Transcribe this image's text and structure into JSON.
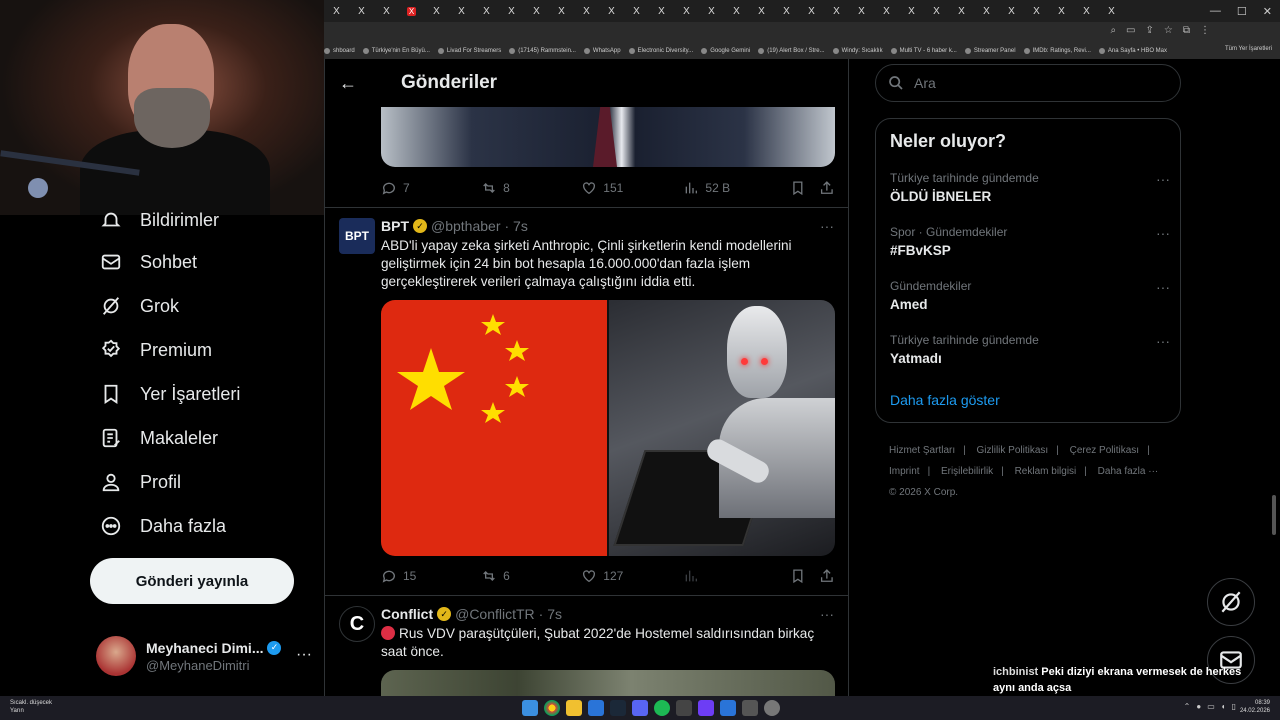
{
  "browser": {
    "tab_count": 32,
    "tab_glyph": "X",
    "bookmarks": [
      "shboard",
      "Türkiye'nin En Büyü...",
      "Livad For Streamers",
      "(17145) Rammstein...",
      "WhatsApp",
      "Electronic Diversity...",
      "Google Gemini",
      "(19) Alert Box / Stre...",
      "Windy: Sıcaklık",
      "Multi TV - 6 haber k...",
      "Streamer Panel",
      "IMDb: Ratings, Revi...",
      "Ana Sayfa • HBO Max"
    ],
    "bookmarks_folder": "Tüm Yer İşaretleri"
  },
  "nav": {
    "items": [
      {
        "label": "Bildirimler",
        "icon": "bell-icon"
      },
      {
        "label": "Sohbet",
        "icon": "mail-icon"
      },
      {
        "label": "Grok",
        "icon": "grok-icon"
      },
      {
        "label": "Premium",
        "icon": "premium-icon"
      },
      {
        "label": "Yer İşaretleri",
        "icon": "bookmark-icon"
      },
      {
        "label": "Makaleler",
        "icon": "article-icon"
      },
      {
        "label": "Profil",
        "icon": "profile-icon"
      },
      {
        "label": "Daha fazla",
        "icon": "more-icon"
      }
    ],
    "post_button": "Gönderi yayınla"
  },
  "account": {
    "name": "Meyhaneci Dimi...",
    "handle": "@MeyhaneDimitri"
  },
  "main": {
    "title": "Gönderiler",
    "prev_tweet_stats": {
      "replies": "7",
      "reposts": "8",
      "likes": "151",
      "views": "52 B"
    },
    "tweets": [
      {
        "name": "BPT",
        "handle": "@bpthaber",
        "time": "· 7s",
        "avatar_text": "BPT",
        "text": "ABD'li yapay zeka şirketi Anthropic, Çinli şirketlerin kendi modellerini geliştirmek için 24 bin bot hesapla 16.000.000'dan fazla işlem gerçekleştirerek verileri çalmaya çalıştığını iddia etti.",
        "stats": {
          "replies": "15",
          "reposts": "6",
          "likes": "127"
        }
      },
      {
        "name": "Conflict",
        "handle": "@ConflictTR",
        "time": "· 7s",
        "avatar_text": "C",
        "text": "Rus VDV paraşütçüleri, Şubat 2022'de Hostemel saldırısından birkaç saat önce."
      }
    ]
  },
  "search": {
    "placeholder": "Ara"
  },
  "trends": {
    "title": "Neler oluyor?",
    "items": [
      {
        "meta": "Türkiye tarihinde gündemde",
        "name": "ÖLDÜ İBNELER"
      },
      {
        "meta": "Spor · Gündemdekiler",
        "name": "#FBvKSP"
      },
      {
        "meta": "Gündemdekiler",
        "name": "Amed"
      },
      {
        "meta": "Türkiye tarihinde gündemde",
        "name": "Yatmadı"
      }
    ],
    "show_more": "Daha fazla göster"
  },
  "footer": {
    "links": [
      "Hizmet Şartları",
      "|",
      "Gizlilik Politikası",
      "|",
      "Çerez Politikası",
      "|",
      "Imprint",
      "|",
      "Erişilebilirlik",
      "|",
      "Reklam bilgisi",
      "|",
      "Daha fazla ···"
    ],
    "copyright": "© 2026 X Corp."
  },
  "chat": {
    "user1": "ichbinist",
    "msg1": "Peki diziyi ekrana vermesek de herkes aynı anda açsa",
    "user2": "ichbinist"
  },
  "taskbar": {
    "weather_line1": "Sıcakl. düşecek",
    "weather_line2": "Yarın",
    "time": "08:39",
    "date": "24.02.2026"
  },
  "colors": {
    "accent": "#1d9bf0",
    "verified_gold": "#e2b719",
    "flag_red": "#de2910",
    "flag_star": "#ffde00"
  }
}
